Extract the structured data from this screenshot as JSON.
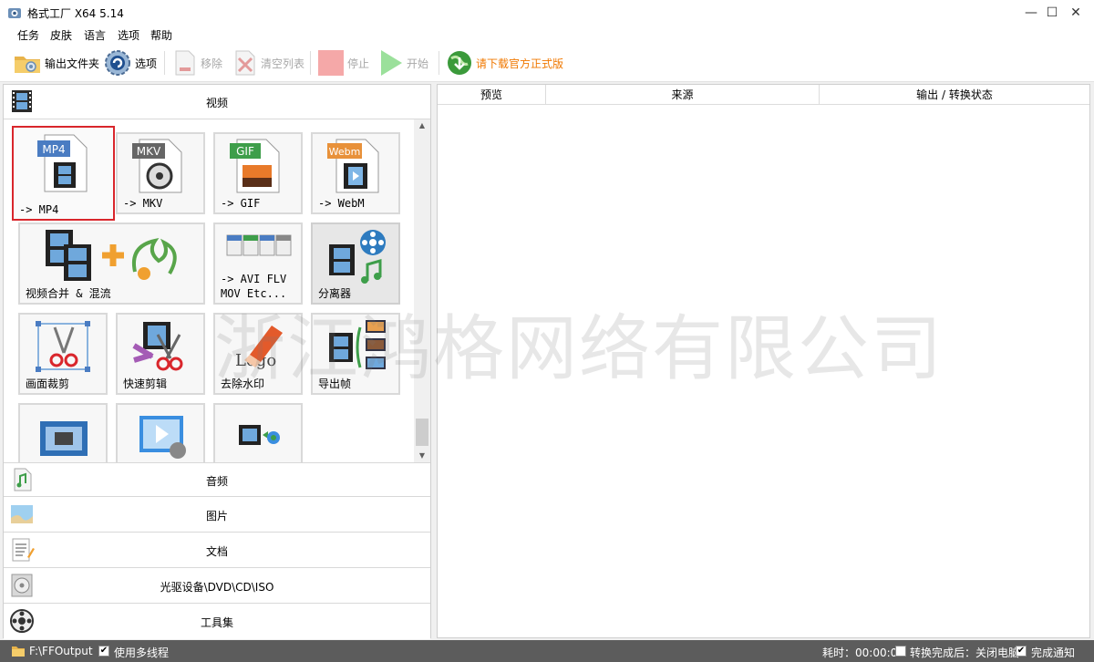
{
  "window": {
    "title": "格式工厂 X64 5.14",
    "minimize": "—",
    "maximize": "☐",
    "close": "✕"
  },
  "menu": [
    "任务",
    "皮肤",
    "语言",
    "选项",
    "帮助"
  ],
  "toolbar": {
    "output_folder": "输出文件夹",
    "options": "选项",
    "remove": "移除",
    "clear_list": "清空列表",
    "stop": "停止",
    "start": "开始",
    "download": "请下载官方正式版"
  },
  "colors": {
    "download_text": "#f07800",
    "selected_border": "#d9262c",
    "statusbar_bg": "#5c5c5c"
  },
  "video_category": "视频",
  "tiles": [
    {
      "label": "-> MP4",
      "badge": "MP4",
      "icon": "mp4-file-icon"
    },
    {
      "label": "-> MKV",
      "badge": "MKV",
      "icon": "mkv-file-icon"
    },
    {
      "label": "-> GIF",
      "badge": "GIF",
      "icon": "gif-file-icon"
    },
    {
      "label": "-> WebM",
      "badge": "Webm",
      "icon": "webm-file-icon"
    },
    {
      "label": "视频合并 & 混流",
      "icon": "video-merge-icon"
    },
    {
      "label": "-> AVI FLV\nMOV Etc...",
      "icon": "multi-format-icon"
    },
    {
      "label": "分离器",
      "icon": "splitter-icon"
    },
    {
      "label": "画面裁剪",
      "icon": "crop-icon"
    },
    {
      "label": "快速剪辑",
      "icon": "quick-clip-icon"
    },
    {
      "label": "去除水印",
      "icon": "remove-watermark-icon"
    },
    {
      "label": "导出帧",
      "icon": "export-frames-icon"
    },
    {
      "label": "",
      "icon": "screen-record-icon"
    },
    {
      "label": "",
      "icon": "video-player-icon"
    },
    {
      "label": "",
      "icon": "video-download-icon"
    }
  ],
  "categories": [
    {
      "label": "音频",
      "icon": "audio-icon"
    },
    {
      "label": "图片",
      "icon": "picture-icon"
    },
    {
      "label": "文档",
      "icon": "document-icon"
    },
    {
      "label": "光驱设备\\DVD\\CD\\ISO",
      "icon": "disc-icon"
    },
    {
      "label": "工具集",
      "icon": "toolbox-icon"
    }
  ],
  "task_table": {
    "columns": [
      "预览",
      "来源",
      "输出 / 转换状态"
    ]
  },
  "watermark_text": "浙江鸿格网络有限公司",
  "status": {
    "output_path": "F:\\FFOutput",
    "multithread_label": "使用多线程",
    "multithread_checked": true,
    "elapsed": "耗时：00:00:00",
    "after_convert": "转换完成后：关闭电脑",
    "after_convert_checked": false,
    "notify": "完成通知",
    "notify_checked": true
  }
}
